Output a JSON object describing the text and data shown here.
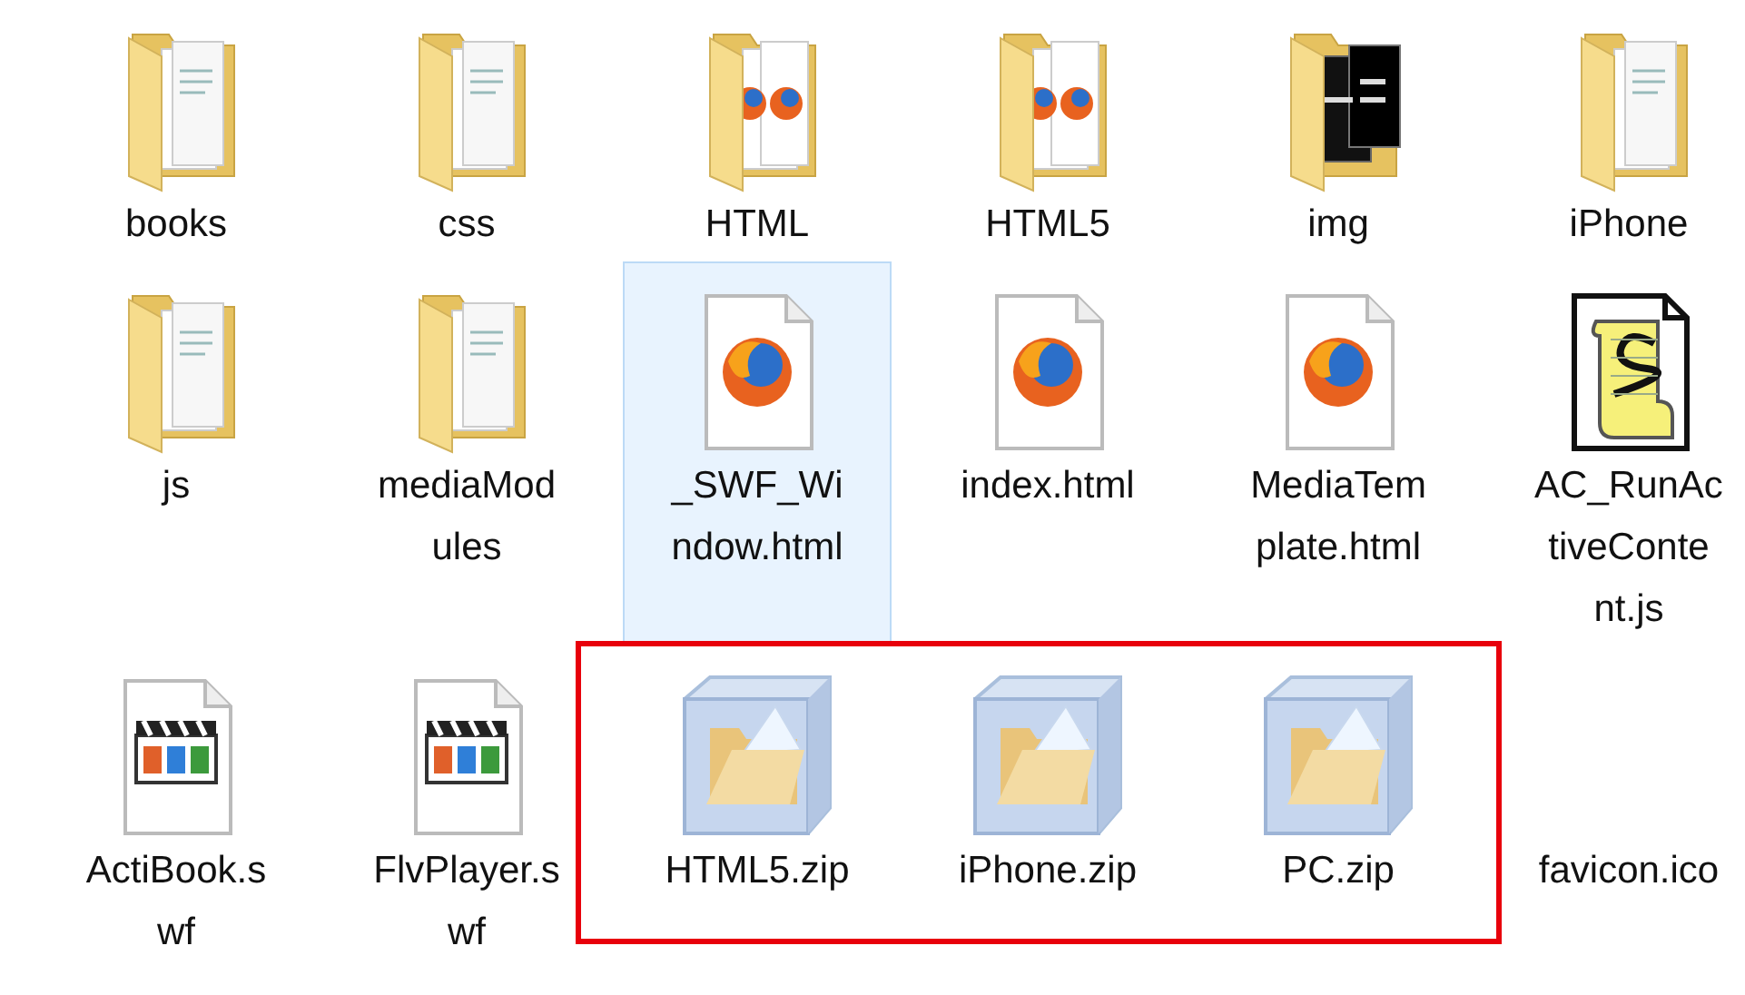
{
  "items": [
    {
      "kind": "folder",
      "label_lines": [
        "books"
      ],
      "selected": false,
      "highlighted": false
    },
    {
      "kind": "folder",
      "label_lines": [
        "css"
      ],
      "selected": false,
      "highlighted": false
    },
    {
      "kind": "webfolder",
      "label_lines": [
        "HTML"
      ],
      "selected": false,
      "highlighted": false
    },
    {
      "kind": "webfolder",
      "label_lines": [
        "HTML5"
      ],
      "selected": false,
      "highlighted": false
    },
    {
      "kind": "photofolder",
      "label_lines": [
        "img"
      ],
      "selected": false,
      "highlighted": false
    },
    {
      "kind": "folder",
      "label_lines": [
        "iPhone"
      ],
      "selected": false,
      "highlighted": false
    },
    {
      "kind": "folder",
      "label_lines": [
        "js"
      ],
      "selected": false,
      "highlighted": false
    },
    {
      "kind": "folder",
      "label_lines": [
        "mediaMod",
        "ules"
      ],
      "selected": false,
      "highlighted": false
    },
    {
      "kind": "webpage",
      "label_lines": [
        "_SWF_Wi",
        "ndow.html"
      ],
      "selected": true,
      "highlighted": false
    },
    {
      "kind": "webpage",
      "label_lines": [
        "index.html"
      ],
      "selected": false,
      "highlighted": false
    },
    {
      "kind": "webpage",
      "label_lines": [
        "MediaTem",
        "plate.html"
      ],
      "selected": false,
      "highlighted": false
    },
    {
      "kind": "script",
      "label_lines": [
        "AC_RunAc",
        "tiveConte",
        "nt.js"
      ],
      "selected": false,
      "highlighted": false
    },
    {
      "kind": "video",
      "label_lines": [
        "ActiBook.s",
        "wf"
      ],
      "selected": false,
      "highlighted": false
    },
    {
      "kind": "video",
      "label_lines": [
        "FlvPlayer.s",
        "wf"
      ],
      "selected": false,
      "highlighted": false
    },
    {
      "kind": "archive",
      "label_lines": [
        "HTML5.zip"
      ],
      "selected": false,
      "highlighted": true
    },
    {
      "kind": "archive",
      "label_lines": [
        "iPhone.zip"
      ],
      "selected": false,
      "highlighted": true
    },
    {
      "kind": "archive",
      "label_lines": [
        "PC.zip"
      ],
      "selected": false,
      "highlighted": true
    },
    {
      "kind": "unknown",
      "label_lines": [
        "favicon.ico"
      ],
      "selected": false,
      "highlighted": false
    }
  ]
}
